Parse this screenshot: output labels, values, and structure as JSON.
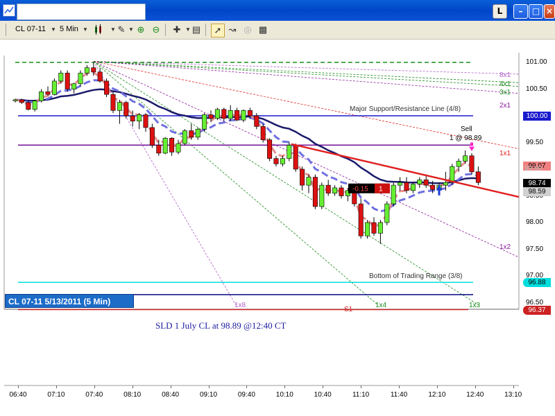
{
  "window": {
    "l_button": "L",
    "min_icon": "minimize-icon",
    "max_icon": "maximize-icon",
    "close_icon": "close-icon"
  },
  "toolbar": {
    "instrument": "CL 07-11",
    "interval": "5 Min"
  },
  "chart_data": {
    "type": "candlestick",
    "instrument_label": "CL 07-11  5/13/2011 (5 Min)",
    "price_axis": {
      "labels": [
        "101.00",
        "100.50",
        "100.00",
        "99.50",
        "99.00",
        "98.50",
        "98.00",
        "97.50",
        "97.00",
        "96.50"
      ],
      "range": [
        96.2,
        101.1
      ]
    },
    "time_axis": [
      "06:40",
      "07:10",
      "07:40",
      "08:10",
      "08:40",
      "09:10",
      "09:40",
      "10:10",
      "10:40",
      "11:10",
      "11:40",
      "12:10",
      "12:40",
      "13:10"
    ],
    "price_boxes": [
      {
        "value": "100.00",
        "bg": "#1a1acd",
        "fg": "#ffffff"
      },
      {
        "value": "99.07",
        "bg": "#f08080",
        "fg": "#000000"
      },
      {
        "value": "98.74",
        "bg": "#000000",
        "fg": "#ffffff"
      },
      {
        "value": "98.59",
        "bg": "#d0d0d0",
        "fg": "#000000"
      },
      {
        "value": "96.88",
        "bg": "#00dddd",
        "fg": "#000000"
      },
      {
        "value": "96.37",
        "bg": "#cc2222",
        "fg": "#ffffff"
      }
    ],
    "right_price_ghost": "99.00",
    "horizontal_lines": [
      {
        "label": "Major Support/Resistance Line (4/8)",
        "price": 100.0,
        "color": "#1a1acd"
      },
      {
        "label": "Bottom of Trading Range (3/8)",
        "price": 96.88,
        "color": "#00dddd"
      },
      {
        "label": "",
        "price": 99.45,
        "color": "#7a1a9a"
      },
      {
        "label": "",
        "price": 96.65,
        "color": "#1a1a8a"
      },
      {
        "label": "",
        "price": 96.37,
        "color": "#cc2222"
      },
      {
        "label": "",
        "price": 101.0,
        "color": "#1a8a1a"
      }
    ],
    "gann_labels": [
      "8x1",
      "4x1",
      "3x1",
      "2x1",
      "1x1",
      "1x2",
      "1x3",
      "1x4",
      "1x8"
    ],
    "sell_annotation": {
      "text": "Sell",
      "detail": "1 @ 98.89"
    },
    "position_badge": {
      "pnl": "-0.15",
      "qty": "1"
    },
    "s1_label": "S1",
    "trade_note": "SLD 1 July CL at 98.89 @12:40 CT",
    "candles": [
      [
        100.28,
        100.32,
        100.25,
        100.3
      ],
      [
        100.3,
        100.32,
        100.22,
        100.25
      ],
      [
        100.25,
        100.28,
        100.1,
        100.12
      ],
      [
        100.12,
        100.3,
        100.08,
        100.28
      ],
      [
        100.28,
        100.5,
        100.25,
        100.45
      ],
      [
        100.45,
        100.55,
        100.38,
        100.4
      ],
      [
        100.4,
        100.7,
        100.38,
        100.65
      ],
      [
        100.65,
        100.85,
        100.6,
        100.8
      ],
      [
        100.8,
        100.85,
        100.45,
        100.5
      ],
      [
        100.5,
        100.62,
        100.42,
        100.6
      ],
      [
        100.6,
        100.85,
        100.55,
        100.8
      ],
      [
        100.8,
        100.95,
        100.75,
        100.9
      ],
      [
        100.9,
        101.0,
        100.75,
        100.82
      ],
      [
        100.82,
        100.9,
        100.62,
        100.65
      ],
      [
        100.65,
        100.7,
        100.35,
        100.4
      ],
      [
        100.4,
        100.45,
        100.05,
        100.1
      ],
      [
        100.1,
        100.3,
        99.85,
        100.25
      ],
      [
        100.25,
        100.28,
        99.95,
        100.0
      ],
      [
        100.0,
        100.1,
        99.8,
        99.9
      ],
      [
        99.9,
        100.05,
        99.75,
        100.02
      ],
      [
        100.02,
        100.05,
        99.7,
        99.78
      ],
      [
        99.78,
        99.85,
        99.4,
        99.45
      ],
      [
        99.45,
        99.55,
        99.25,
        99.3
      ],
      [
        99.3,
        99.6,
        99.28,
        99.58
      ],
      [
        99.58,
        99.6,
        99.25,
        99.32
      ],
      [
        99.32,
        99.55,
        99.28,
        99.48
      ],
      [
        99.48,
        99.75,
        99.45,
        99.72
      ],
      [
        99.72,
        99.85,
        99.55,
        99.6
      ],
      [
        99.6,
        99.78,
        99.55,
        99.75
      ],
      [
        99.75,
        100.05,
        99.7,
        100.02
      ],
      [
        100.02,
        100.1,
        99.88,
        99.95
      ],
      [
        99.95,
        100.15,
        99.92,
        100.12
      ],
      [
        100.12,
        100.15,
        99.9,
        99.95
      ],
      [
        99.95,
        100.2,
        99.9,
        100.1
      ],
      [
        100.1,
        100.15,
        99.9,
        99.92
      ],
      [
        99.92,
        100.12,
        99.88,
        100.1
      ],
      [
        100.1,
        100.15,
        99.95,
        100.0
      ],
      [
        100.0,
        100.05,
        99.75,
        99.8
      ],
      [
        99.8,
        99.85,
        99.5,
        99.55
      ],
      [
        99.55,
        99.58,
        99.15,
        99.2
      ],
      [
        99.2,
        99.25,
        99.05,
        99.1
      ],
      [
        99.1,
        99.25,
        99.05,
        99.2
      ],
      [
        99.2,
        99.5,
        99.15,
        99.45
      ],
      [
        99.45,
        99.48,
        98.95,
        99.0
      ],
      [
        99.0,
        99.05,
        98.6,
        98.7
      ],
      [
        98.7,
        98.9,
        98.55,
        98.85
      ],
      [
        98.85,
        98.9,
        98.25,
        98.3
      ],
      [
        98.3,
        98.75,
        98.25,
        98.7
      ],
      [
        98.7,
        98.8,
        98.5,
        98.55
      ],
      [
        98.55,
        98.7,
        98.5,
        98.65
      ],
      [
        98.65,
        98.7,
        98.45,
        98.5
      ],
      [
        98.5,
        98.65,
        98.4,
        98.6
      ],
      [
        98.6,
        98.62,
        98.3,
        98.35
      ],
      [
        98.35,
        98.45,
        97.7,
        97.75
      ],
      [
        97.75,
        98.05,
        97.7,
        98.0
      ],
      [
        98.0,
        98.1,
        97.75,
        97.8
      ],
      [
        97.8,
        98.05,
        97.6,
        98.0
      ],
      [
        98.0,
        98.4,
        97.95,
        98.35
      ],
      [
        98.35,
        98.75,
        98.3,
        98.7
      ],
      [
        98.7,
        98.85,
        98.6,
        98.75
      ],
      [
        98.75,
        98.85,
        98.55,
        98.6
      ],
      [
        98.6,
        98.75,
        98.55,
        98.72
      ],
      [
        98.72,
        98.85,
        98.65,
        98.8
      ],
      [
        98.8,
        98.9,
        98.65,
        98.7
      ],
      [
        98.7,
        98.78,
        98.55,
        98.62
      ],
      [
        98.62,
        98.75,
        98.55,
        98.7
      ],
      [
        98.7,
        98.95,
        98.6,
        98.75
      ],
      [
        98.75,
        99.1,
        98.7,
        99.05
      ],
      [
        99.05,
        99.2,
        98.95,
        99.15
      ],
      [
        99.15,
        99.35,
        99.1,
        99.25
      ],
      [
        99.25,
        99.3,
        98.9,
        98.95
      ],
      [
        98.95,
        99.05,
        98.7,
        98.75
      ]
    ]
  }
}
